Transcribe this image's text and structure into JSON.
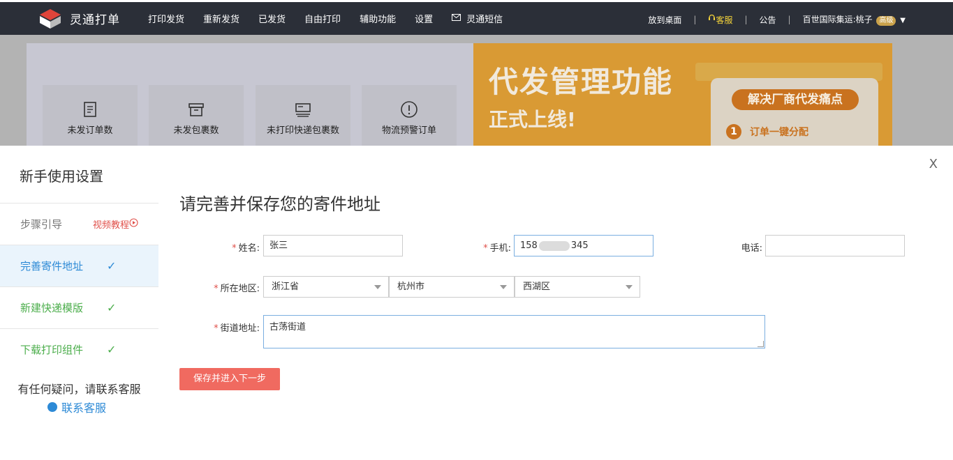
{
  "app": {
    "name": "灵通打单"
  },
  "nav": {
    "items": [
      "打印发货",
      "重新发货",
      "已发货",
      "自由打印",
      "辅助功能",
      "设置"
    ],
    "sms": "灵通短信"
  },
  "top_right": {
    "desktop": "放到桌面",
    "service": "客服",
    "notice": "公告",
    "account": "百世国际集运:桃子",
    "badge": "高级"
  },
  "dashboard": {
    "stats": [
      "未发订单数",
      "未发包裹数",
      "未打印快递包裹数",
      "物流预警订单"
    ],
    "banner": {
      "headline": "代发管理功能",
      "subline": "正式上线!",
      "pill": "解决厂商代发痛点",
      "point_num": "1",
      "point_text": "订单一键分配"
    }
  },
  "modal": {
    "close": "X",
    "title": "新手使用设置",
    "steps": {
      "guide": "步骤引导",
      "video": "视频教程",
      "address": "完善寄件地址",
      "template": "新建快递模版",
      "component": "下载打印组件"
    },
    "help": "有任何疑问，请联系客服",
    "help_link": "联系客服",
    "form": {
      "title": "请完善并保存您的寄件地址",
      "name_label": "姓名:",
      "name_value": "张三",
      "phone_label": "手机:",
      "phone_prefix": "158",
      "phone_suffix": "345",
      "tel_label": "电话:",
      "tel_value": "",
      "region_label": "所在地区:",
      "province": "浙江省",
      "city": "杭州市",
      "district": "西湖区",
      "street_label": "街道地址:",
      "street_value": "古荡街道",
      "save": "保存并进入下一步"
    }
  }
}
